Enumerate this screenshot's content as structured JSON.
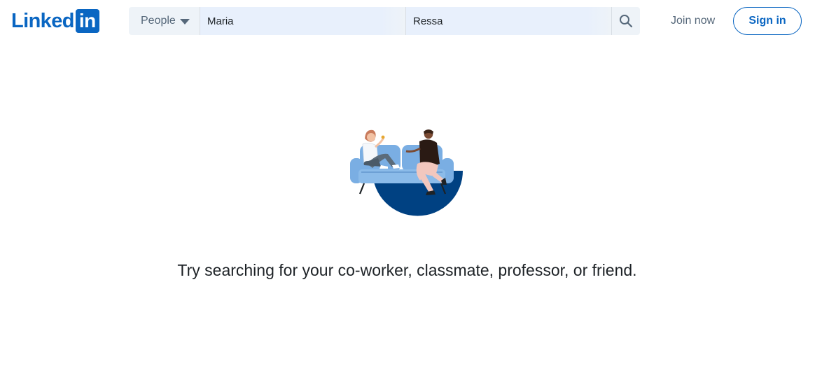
{
  "header": {
    "logo": {
      "word": "Linked",
      "box": "in"
    },
    "search": {
      "category_label": "People",
      "first_name_value": "Maria",
      "last_name_value": "Ressa"
    },
    "join_label": "Join now",
    "signin_label": "Sign in"
  },
  "main": {
    "prompt": "Try searching for your co-worker, classmate, professor, or friend."
  },
  "colors": {
    "brand": "#0a66c2",
    "field_bg": "#e8f0fc",
    "muted_text": "#56687a",
    "illustration_navy": "#004182",
    "illustration_sofa": "#7aaee3"
  }
}
